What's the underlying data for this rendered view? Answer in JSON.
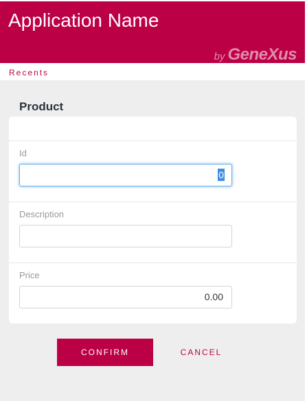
{
  "header": {
    "app_title": "Application Name",
    "brand_by": "by",
    "brand_name": "GeneXus"
  },
  "breadcrumb": {
    "recents_label": "Recents"
  },
  "form": {
    "title": "Product",
    "fields": [
      {
        "label": "Id",
        "value": "0",
        "selected": true,
        "focused": true
      },
      {
        "label": "Description",
        "value": ""
      },
      {
        "label": "Price",
        "value": "0.00"
      }
    ]
  },
  "actions": {
    "confirm_label": "CONFIRM",
    "cancel_label": "CANCEL"
  },
  "colors": {
    "brand": "#bc0046",
    "content_background": "#eeeeee",
    "focus_ring": "#6ab0ea",
    "selection": "#3e8ee0"
  }
}
